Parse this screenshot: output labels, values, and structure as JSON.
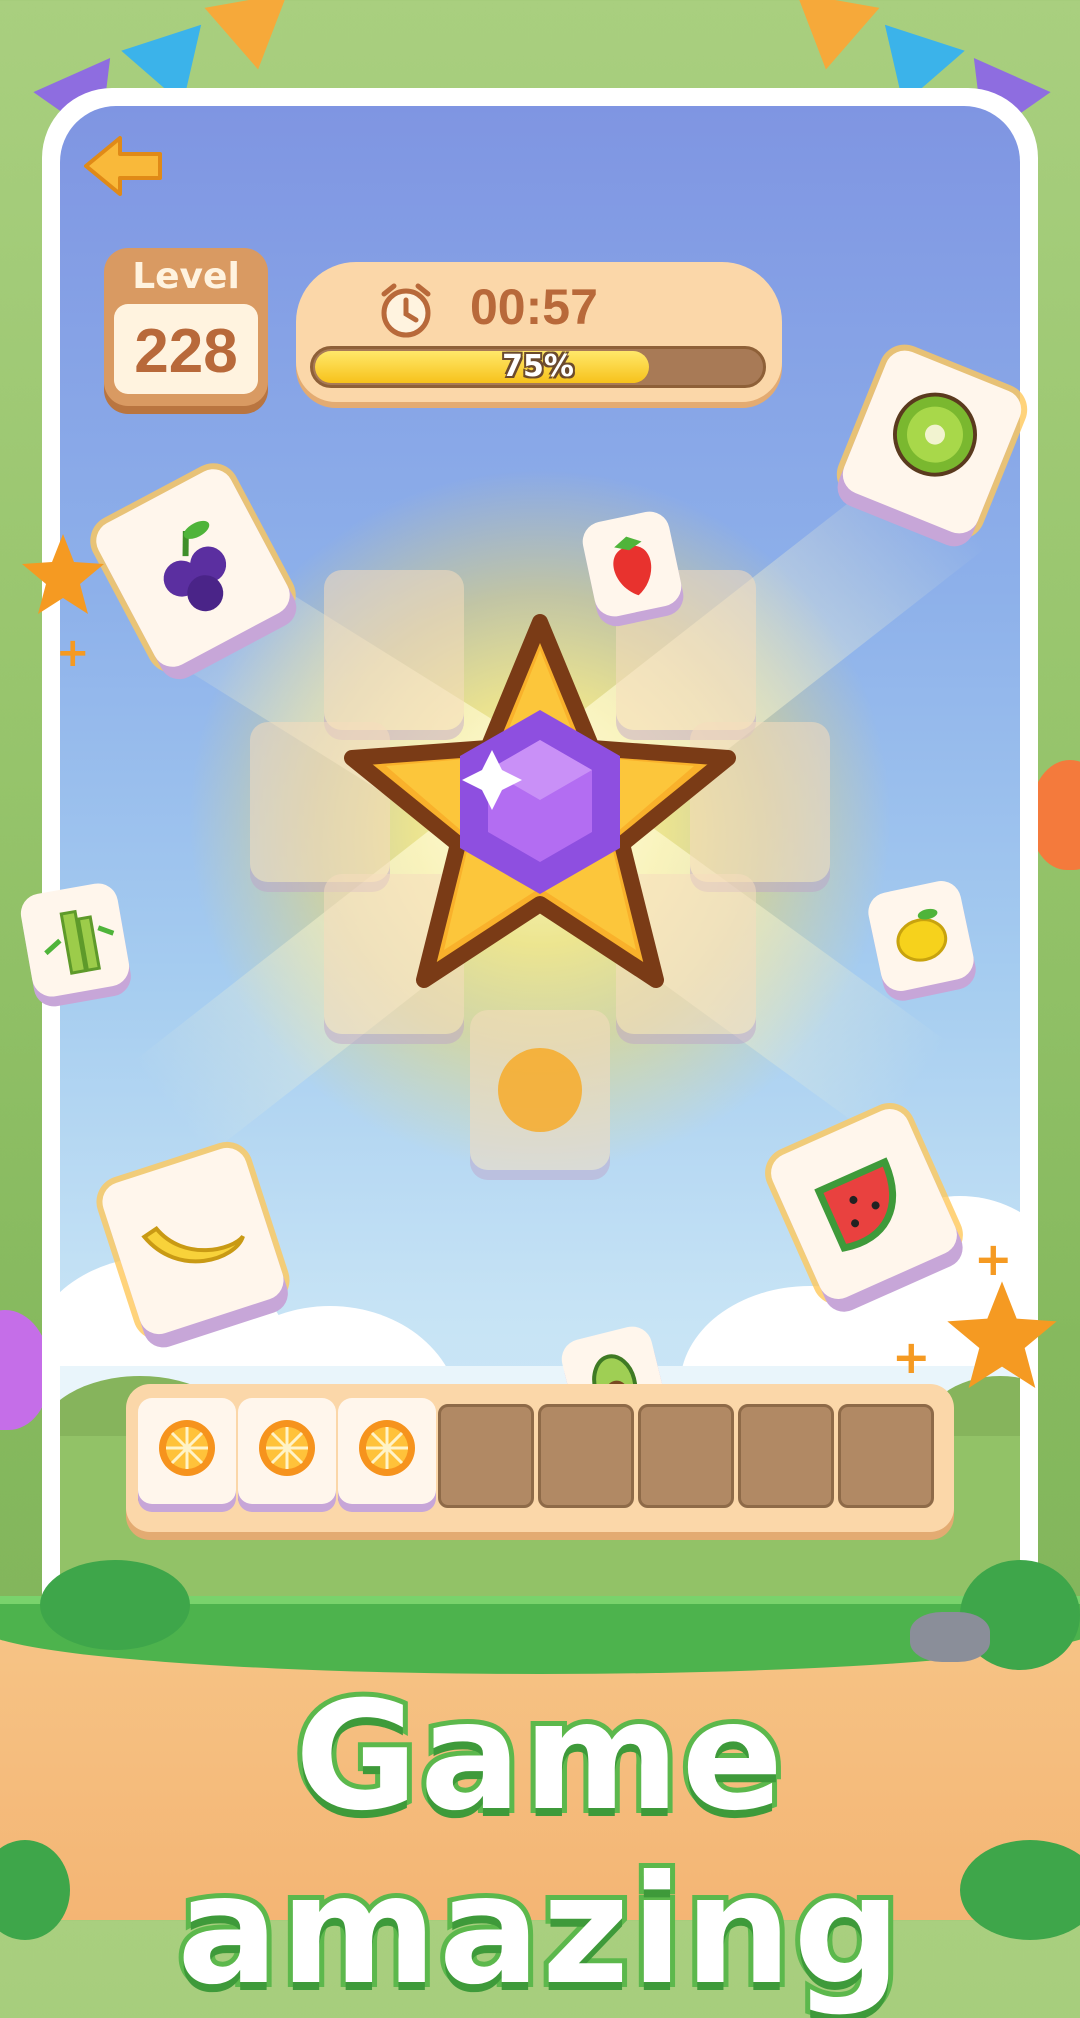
{
  "header": {
    "back_icon": "back-arrow-icon",
    "level": {
      "label": "Level",
      "value": "228"
    },
    "timer": {
      "time": "00:57",
      "progress_percent": 75,
      "progress_label": "75%",
      "icon": "alarm-clock-icon"
    }
  },
  "board": {
    "center_reward": "star-gem-icon",
    "flying_tiles": [
      "grapes",
      "strawberry",
      "kiwi",
      "sugarcane",
      "lemon",
      "banana",
      "watermelon",
      "avocado"
    ],
    "ghost_tiles": 7
  },
  "tray": {
    "slots_total": 8,
    "filled": [
      "orange",
      "orange",
      "orange"
    ]
  },
  "banner": {
    "headline": "Game amazing"
  },
  "colors": {
    "accent_orange": "#d99a62",
    "text_brown": "#b8693a",
    "progress_yellow": "#f7c21b",
    "headline_green": "#5cb84c",
    "gem_purple": "#8e4fe0"
  }
}
